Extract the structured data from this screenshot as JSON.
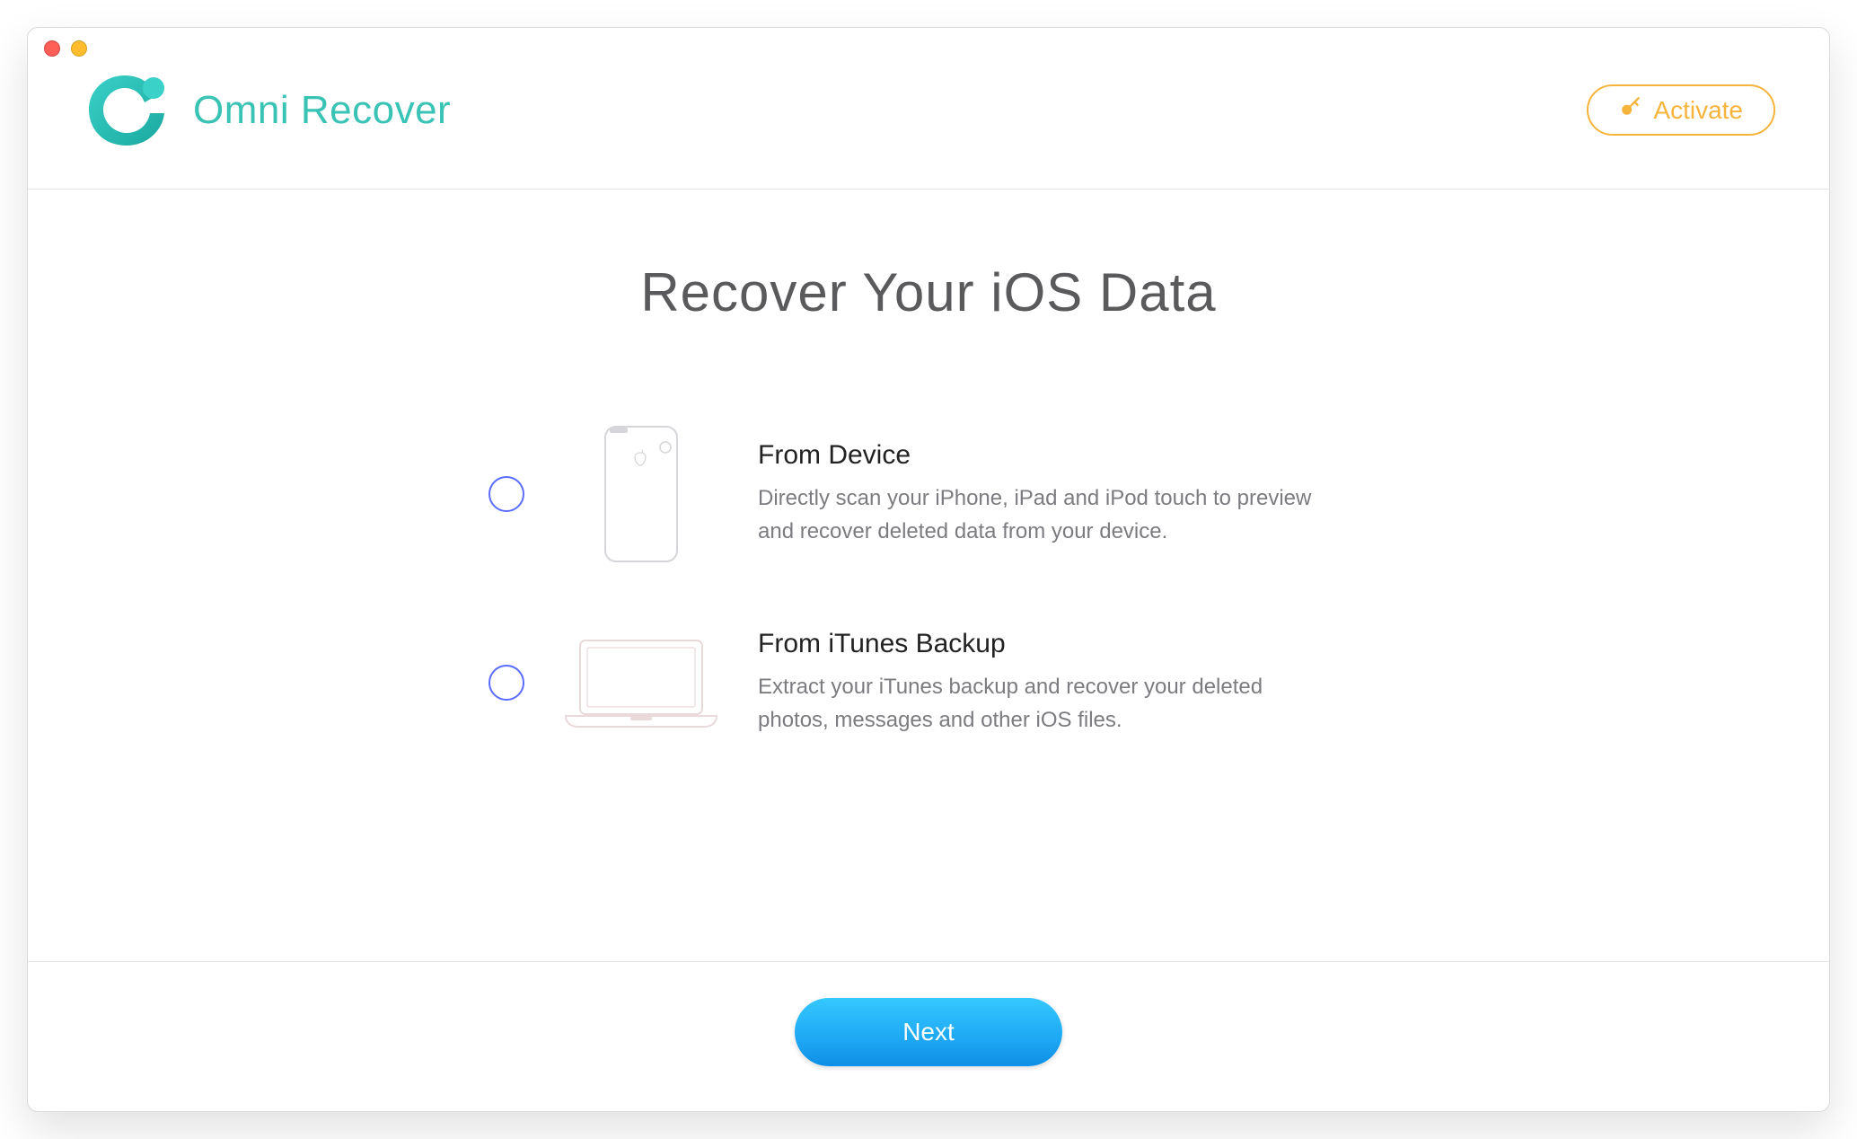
{
  "app": {
    "name": "Omni Recover"
  },
  "header": {
    "activate_label": "Activate"
  },
  "main": {
    "title": "Recover Your iOS Data",
    "options": [
      {
        "title": "From Device",
        "description": "Directly scan your iPhone, iPad and iPod touch to preview and recover deleted data from your device."
      },
      {
        "title": "From iTunes Backup",
        "description": "Extract your iTunes backup and recover your deleted photos, messages and other iOS files."
      }
    ]
  },
  "footer": {
    "next_label": "Next"
  },
  "colors": {
    "brand": "#39c3b5",
    "accent": "#f6b43c",
    "primary_button_start": "#35c8ff",
    "primary_button_end": "#0f8fe6",
    "radio_border": "#5a6dff"
  }
}
